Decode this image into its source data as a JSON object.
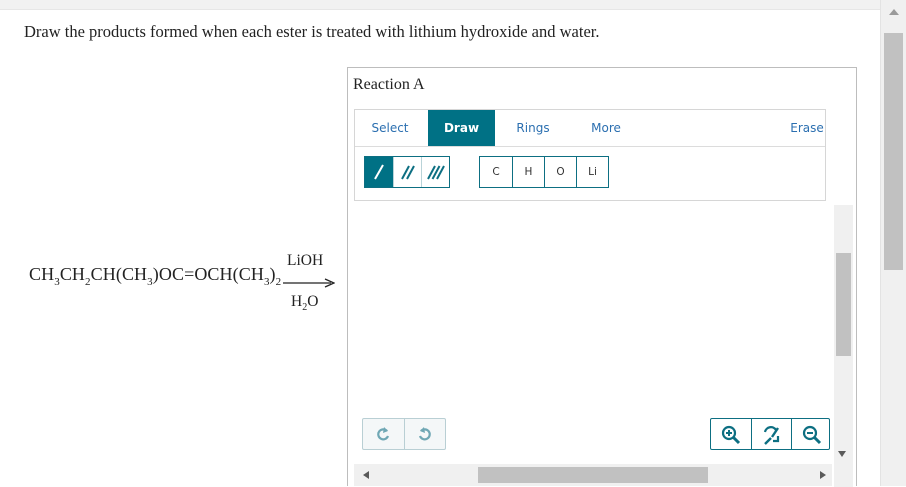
{
  "question": "Draw the products formed when each ester is treated with lithium hydroxide and water.",
  "reaction": {
    "reactant_parts": [
      "CH",
      "3",
      "CH",
      "2",
      "CH(CH",
      "3",
      ")OC=OCH(CH",
      "3",
      ")",
      "2"
    ],
    "reagent_top": "LiOH",
    "reagent_bottom_main": "H",
    "reagent_bottom_sub": "2",
    "reagent_bottom_end": "O"
  },
  "panel": {
    "title": "Reaction A",
    "tabs": {
      "select": "Select",
      "draw": "Draw",
      "rings": "Rings",
      "more": "More",
      "erase": "Erase"
    },
    "active_tab": "Draw",
    "bond_tools": [
      "single-bond-icon",
      "double-bond-icon",
      "triple-bond-icon"
    ],
    "atoms": [
      "C",
      "H",
      "O",
      "Li"
    ],
    "undo_icons": [
      "undo-icon",
      "redo-icon"
    ],
    "zoom_icons": [
      "zoom-in-icon",
      "zoom-reset-icon",
      "zoom-out-icon"
    ]
  },
  "colors": {
    "accent": "#007185",
    "link": "#2b6fb0"
  }
}
